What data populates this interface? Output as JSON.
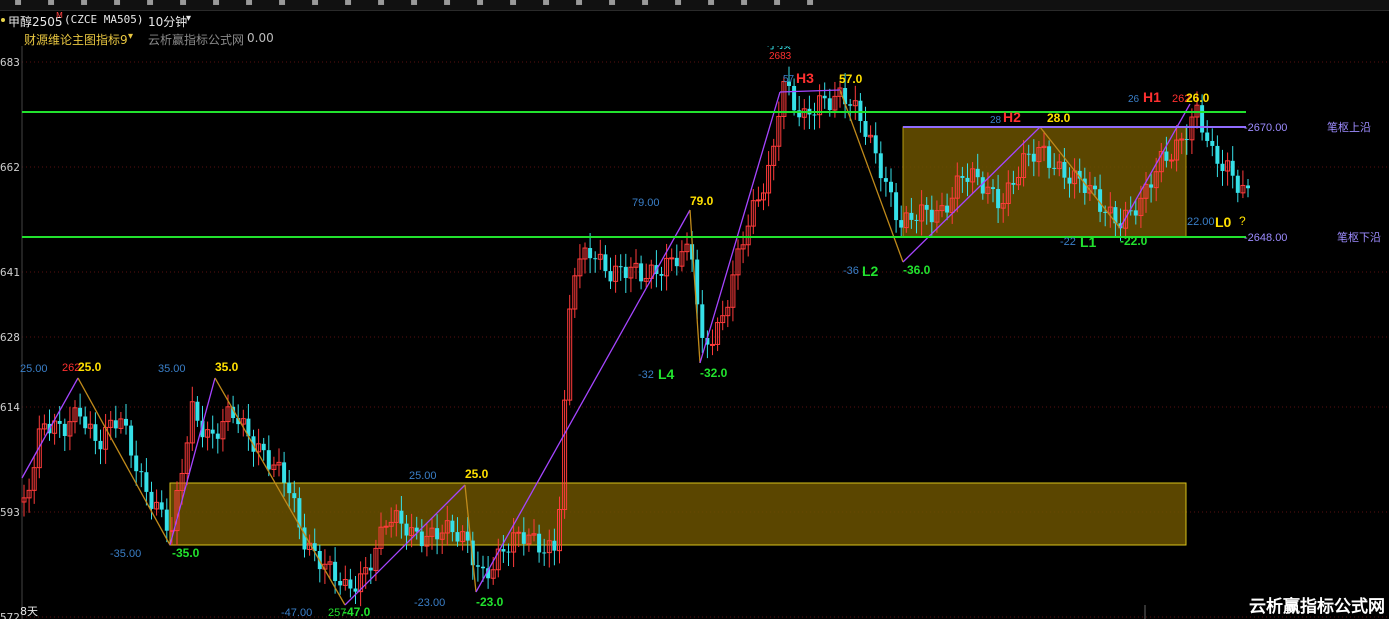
{
  "toolbar": {
    "icons": [
      "menu-icon",
      "list-icon",
      "crosshair-icon",
      "line-tool-icon",
      "draw-icon",
      "zoom-icon",
      "grid-icon",
      "indicator-icon",
      "h-line-icon",
      "pen-icon",
      "channel-icon",
      "fib-icon",
      "rect-icon",
      "text-icon",
      "arrow-up-icon",
      "arrow-down-icon",
      "cursor-icon",
      "ellipse-icon",
      "clock-icon",
      "note-icon",
      "save-icon",
      "layout-icon",
      "play-icon",
      "table-icon",
      "settings-icon"
    ]
  },
  "header": {
    "symbol": "甲醇2505",
    "mark": "M",
    "code": "(CZCE MA505)",
    "period": "10分钟",
    "dropdown_glyph": "▾"
  },
  "indicator_bar": {
    "name": "财源维论主图指标9",
    "source": "云析赢指标公式网",
    "value": "0.00"
  },
  "price_axis": {
    "labels": [
      {
        "text": "683",
        "price": 2683
      },
      {
        "text": "662",
        "price": 2662
      },
      {
        "text": "641",
        "price": 2641
      },
      {
        "text": "628",
        "price": 2628
      },
      {
        "text": "614",
        "price": 2614
      },
      {
        "text": "593",
        "price": 2593
      },
      {
        "text": "572",
        "price": 2572
      }
    ]
  },
  "channel": {
    "upper_price": 2670,
    "lower_price": 2648,
    "upper_label": "-2670.00",
    "lower_label": "-2648.00",
    "upper_name": "笔枢上沿",
    "lower_name": "笔枢下沿"
  },
  "annotations": {
    "top_label": "小顶",
    "top_price": "2683",
    "H3": "H3",
    "H2": "H2",
    "H1": "H1",
    "L4": "L4",
    "L2": "L2",
    "L1": "L1",
    "L0": "L0",
    "qmark": "?",
    "v_57": "57.0",
    "v_57_small": "57",
    "v_79": "79.0",
    "v_79_small": "79.00",
    "v_28": "28.0",
    "v_28_small": "28",
    "v_26": "26.0",
    "v_26_small": "26",
    "v_262": "262",
    "v_neg36": "-36.0",
    "v_neg36_small": "-36",
    "v_neg32": "-32.0",
    "v_neg32_small": "-32",
    "v_neg22": "-22.0",
    "v_neg22_small": "-22",
    "v_22_small": "22.00",
    "v_25a": "25.0",
    "v_25a_small": "25.00",
    "v_262a": "262",
    "v_35": "35.0",
    "v_35_small": "35.00",
    "v_neg35": "-35.0",
    "v_neg35_small": "-35.00",
    "v_25b": "25.0",
    "v_25b_small": "25.00",
    "v_neg47": "-47.0",
    "v_neg47_small": "-47.00",
    "v_257": "257",
    "v_neg23": "-23.0",
    "v_neg23_small": "-23.00"
  },
  "footer": {
    "days": "8天",
    "watermark": "云析赢指标公式网"
  },
  "colors": {
    "up": "#ff3b3b",
    "down": "#36e0e8",
    "channel_line": "#22e22e",
    "zone_fill": "#6b5200",
    "zone_border": "#d9c21a",
    "zigzag_purple": "#a545ff",
    "zigzag_orange": "#c08a1a",
    "yellow_text": "#ffe000",
    "green_text": "#22e22e",
    "red_text": "#ff3030",
    "blue_small": "#3a7fc8"
  },
  "chart_data": {
    "type": "candlestick",
    "price_range": [
      2571,
      2688
    ],
    "candles": []
  }
}
